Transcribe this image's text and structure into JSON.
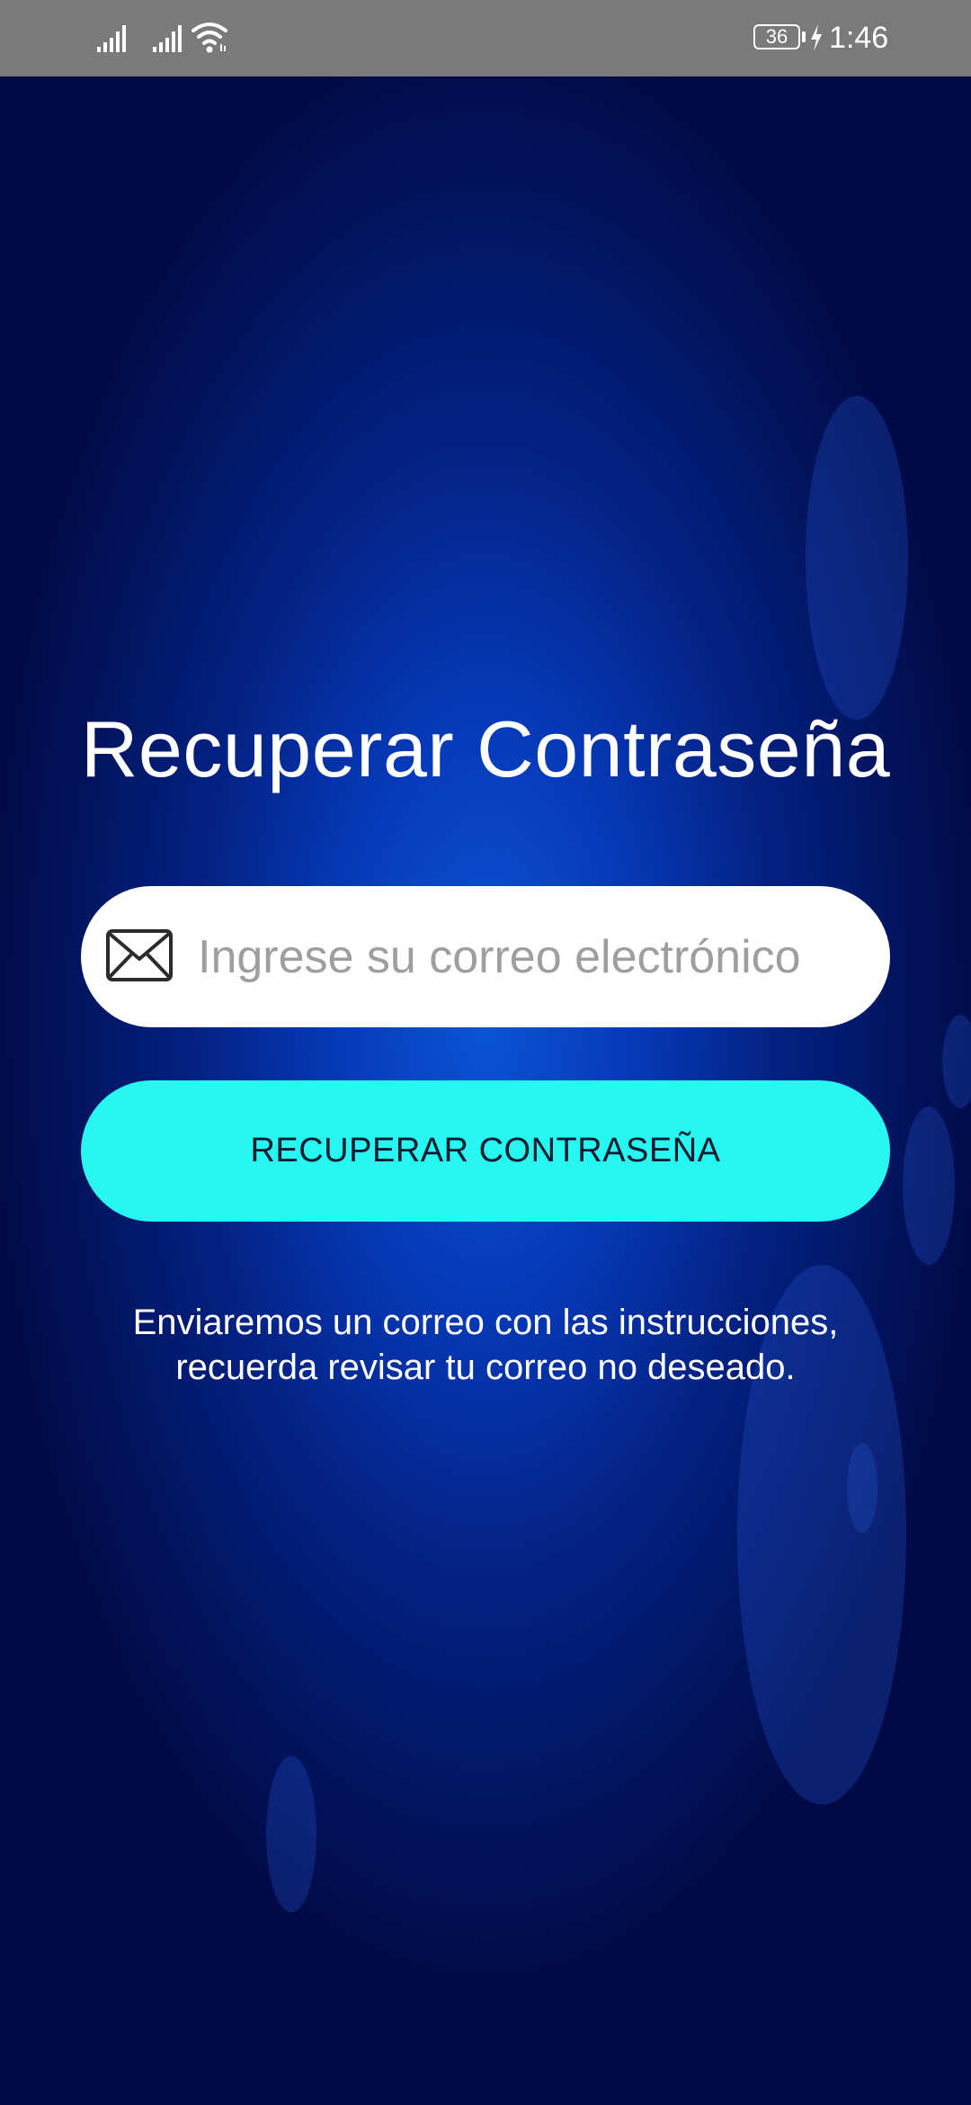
{
  "status_bar": {
    "time": "1:46",
    "battery_level": "36",
    "icons": [
      "signal-icon",
      "signal-icon",
      "wifi-icon",
      "battery-icon",
      "charging-bolt-icon"
    ]
  },
  "screen": {
    "title": "Recuperar Contraseña",
    "email_field": {
      "value": "",
      "placeholder": "Ingrese su correo electrónico",
      "icon": "mail-icon"
    },
    "recover_button_label": "RECUPERAR CONTRASEÑA",
    "info_lines": [
      "Enviaremos un correo con las instrucciones,",
      "recuerda revisar tu correo no deseado."
    ]
  },
  "colors": {
    "background_center": "#0a55d6",
    "background_edge": "#010a45",
    "status_bar": "#7a7a7a",
    "button": "#26f7f0",
    "input_background": "#ffffff",
    "placeholder": "#9e9e9e"
  }
}
